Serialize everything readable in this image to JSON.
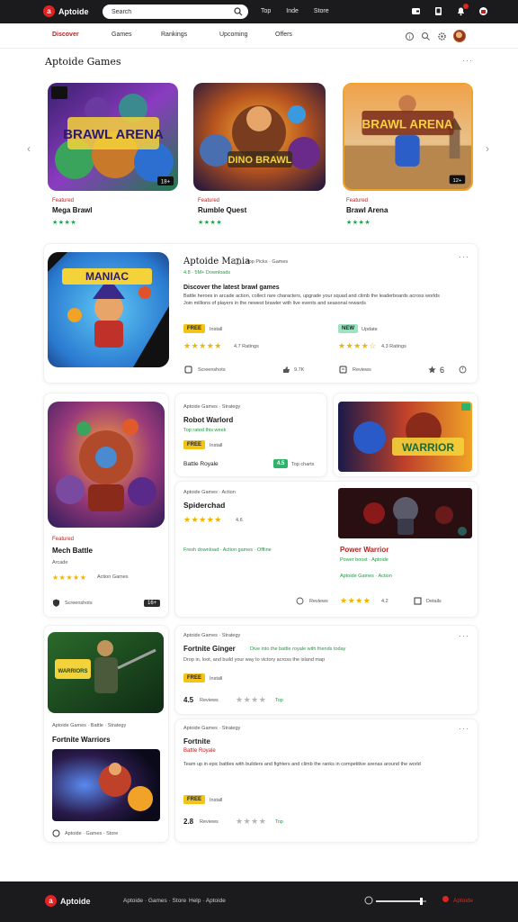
{
  "topbar": {
    "logo_badge": "a",
    "logo_text": "Aptoide",
    "search": {
      "value": "Search",
      "placeholder": "Search"
    },
    "links": [
      "Top",
      "Inde",
      "Store"
    ],
    "icons": [
      "wallet-icon",
      "device-icon",
      "bell-icon",
      "gift-icon"
    ]
  },
  "nav": {
    "tabs": [
      "Discover",
      "Games",
      "Rankings",
      "Upcoming",
      "Offers"
    ],
    "icons": [
      "help-icon",
      "search-icon",
      "settings-icon"
    ]
  },
  "featured": {
    "title": "Aptoide Games",
    "more": "···",
    "items": [
      {
        "category": "Featured",
        "title": "Mega Brawl",
        "stars": "★★★★",
        "badge": "18+",
        "art_title": "BRAWL ARENA"
      },
      {
        "category": "Featured",
        "title": "Rumble Quest",
        "stars": "★★★★",
        "art_title": "DINO BRAWL"
      },
      {
        "category": "Featured",
        "title": "Brawl Arena",
        "stars": "★★★★",
        "badge": "12+",
        "art_title": "BRAWL ARENA"
      }
    ]
  },
  "hero": {
    "title": "Aptoide Mania",
    "meta": "Top Picks · Games",
    "submeta": "4.8 · 5M+ Downloads",
    "more": "···",
    "art_title": "MANIAC",
    "headline": "Discover the latest brawl games",
    "desc_line1": "Battle heroes in arcade action, collect rare characters, upgrade your squad and climb the leaderboards across worlds",
    "desc_line2": "Join millions of players in the newest brawler with live events and seasonal rewards",
    "left_col": {
      "price": "FREE",
      "label": "Install",
      "stars": "★★★★★",
      "rating": "4.7 Ratings",
      "bottom_label": "Screenshots",
      "count": "9.7K"
    },
    "right_col": {
      "price": "NEW",
      "label": "Update",
      "stars": "★★★★☆",
      "rating": "4.3 Ratings",
      "bottom_label": "Reviews",
      "count": "6"
    }
  },
  "row2": {
    "left": {
      "category": "Featured",
      "title": "Mech Battle",
      "sub": "Arcade",
      "stars": "★★★★★",
      "rating_text": "Action Games",
      "bottom_label": "Screenshots",
      "tag": "16+"
    },
    "panel_a": {
      "meta": "Aptoide Games · Strategy",
      "title": "Robot Warlord",
      "price": "FREE",
      "price_label": "Install",
      "green_line": "Top rated this week",
      "footer_label": "Battle Royale",
      "footer_tag": "4.5",
      "footer_right": "Top charts"
    },
    "panel_b": {
      "meta": "Aptoide Games · Action",
      "title": "Spiderchad",
      "stars": "★★★★★",
      "rating": "4.6",
      "green_line": "Fresh download · Action games · Offline",
      "art_title": "WARRIOR"
    },
    "panel_c": {
      "title": "Power Warrior",
      "green_line": "Power boost · Aptoide",
      "stars": "★★★★",
      "rating": "4.2",
      "link1": "Reviews",
      "link2": "Details"
    }
  },
  "row3": {
    "left": {
      "meta": "Aptoide Games · Battle · Strategy",
      "title": "Fortnite Warriors",
      "bottom_label": "Aptoide · Games · Store",
      "art_title": "WARRIORS"
    },
    "panel_a": {
      "meta": "Aptoide Games · Strategy",
      "title": "Fortnite Ginger",
      "green_line": "Dive into the battle royale with friends today",
      "desc": "Drop in, loot, and build your way to victory across the island map",
      "price": "FREE",
      "price_label": "Install",
      "rating": "4.5",
      "rating_label": "Reviews",
      "stars": "★★★★",
      "right": "Top"
    },
    "panel_b": {
      "meta": "Aptoide Games · Strategy",
      "title": "Fortnite",
      "red_line": "Battle Royale",
      "desc": "Team up in epic battles with builders and fighters and climb the ranks in competitive arenas around the world",
      "price": "FREE",
      "price_label": "Install",
      "rating": "2.8",
      "rating_label": "Reviews",
      "stars": "★★★★",
      "right": "Top"
    }
  },
  "footer": {
    "logo_text": "Aptoide",
    "link1": "Aptoide · Games · Store",
    "link2": "Help · Aptoide",
    "right": "Aptoide",
    "volume_level": 0.9
  }
}
